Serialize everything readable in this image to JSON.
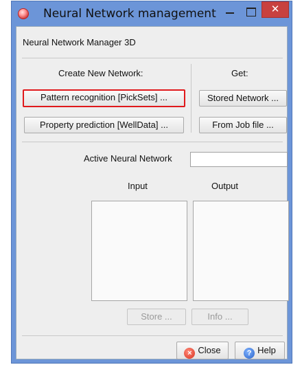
{
  "window": {
    "title": "Neural Network management",
    "close_glyph": "✕"
  },
  "header": {
    "label": "Neural Network Manager 3D"
  },
  "create": {
    "heading": "Create New Network:",
    "pattern_button": "Pattern recognition [PickSets] ...",
    "property_button": "Property prediction [WellData] ..."
  },
  "get": {
    "heading": "Get:",
    "stored_button": "Stored Network ...",
    "job_button": "From Job file ..."
  },
  "active": {
    "label": "Active Neural Network",
    "value": ""
  },
  "lists": {
    "input_label": "Input",
    "output_label": "Output"
  },
  "actions": {
    "store_button": "Store ...",
    "info_button": "Info ..."
  },
  "footer": {
    "close_button": "Close",
    "help_button": "Help",
    "help_glyph": "?",
    "close_glyph": "×"
  },
  "colors": {
    "title_bar": "#6c95d8",
    "close_button": "#c8413f",
    "highlight": "#e0181b"
  },
  "icons": [
    "app-icon",
    "minimize-icon",
    "maximize-icon",
    "close-icon",
    "close-x-icon",
    "help-icon"
  ]
}
